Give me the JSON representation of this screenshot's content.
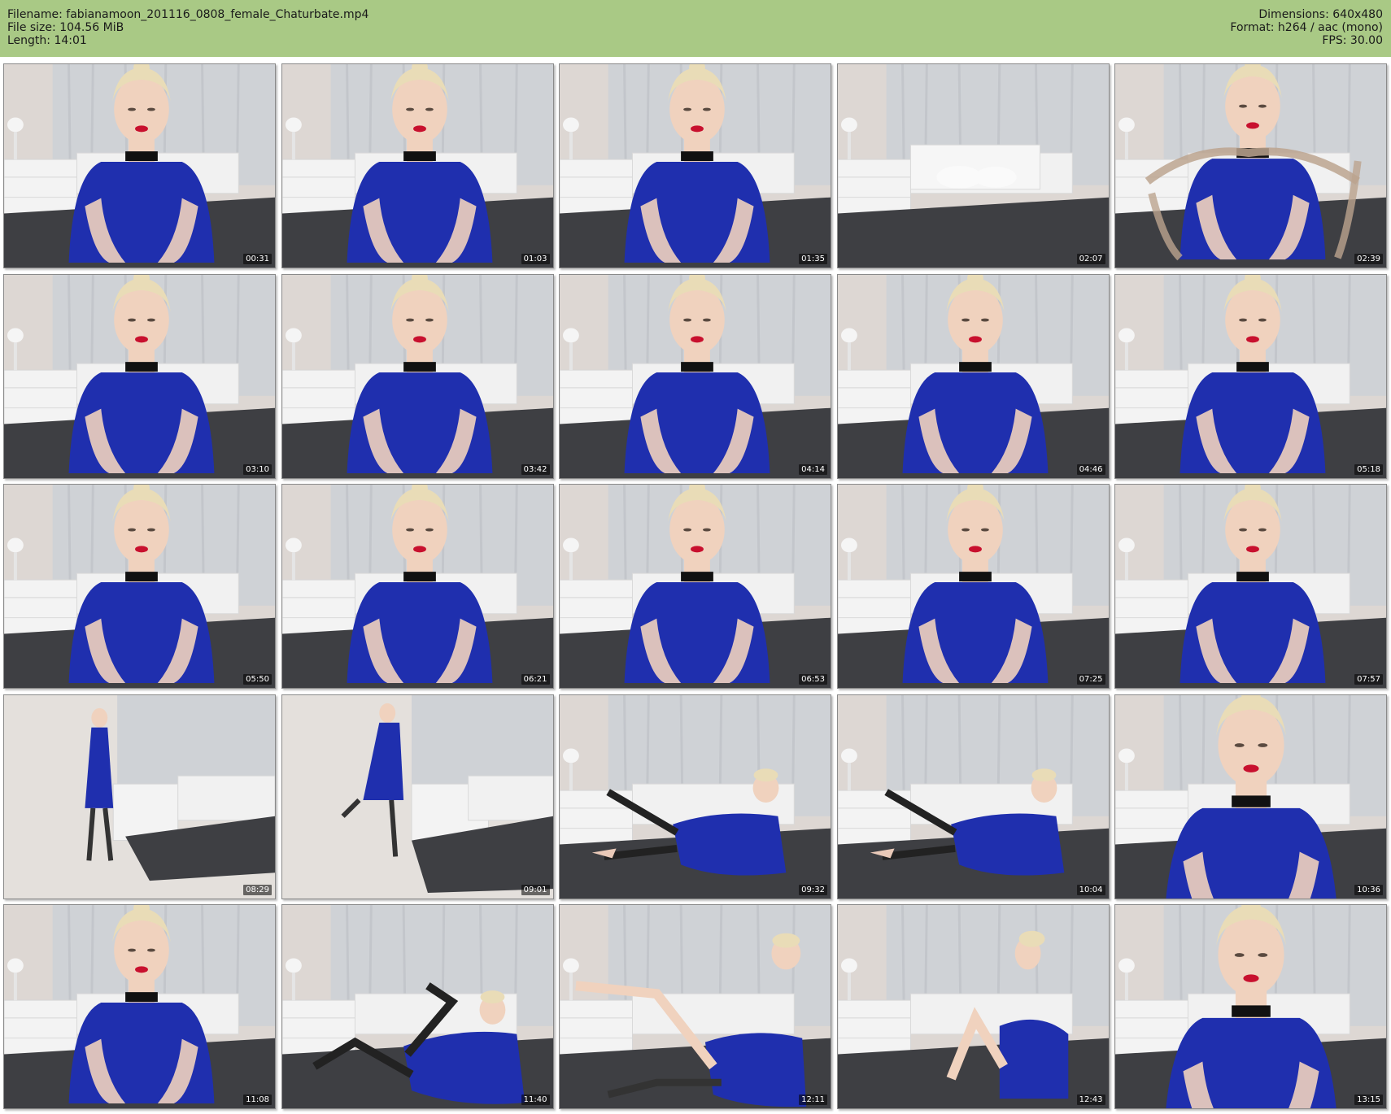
{
  "header": {
    "filename": "Filename: fabianamoon_201116_0808_female_Chaturbate.mp4",
    "filesize": "File size: 104.56 MiB",
    "length": "Length: 14:01",
    "dimensions": "Dimensions: 640x480",
    "format": "Format: h264 / aac (mono)",
    "fps": "FPS: 30.00"
  },
  "colors": {
    "header_bg": "#a9c985",
    "dress": "#1f2fae",
    "wall": "#ddd7d3",
    "curtain": "#cfd2d6",
    "bed_cover": "#3e3f43",
    "skin": "#f0d2be",
    "hair": "#e9dcb7"
  },
  "thumbnails": [
    {
      "time": "00:31",
      "scene": "sit-center"
    },
    {
      "time": "01:03",
      "scene": "sit-center"
    },
    {
      "time": "01:35",
      "scene": "sit-center"
    },
    {
      "time": "02:07",
      "scene": "empty-bed"
    },
    {
      "time": "02:39",
      "scene": "stockings-hold"
    },
    {
      "time": "03:10",
      "scene": "sit-center"
    },
    {
      "time": "03:42",
      "scene": "sit-center"
    },
    {
      "time": "04:14",
      "scene": "sit-center"
    },
    {
      "time": "04:46",
      "scene": "sit-center"
    },
    {
      "time": "05:18",
      "scene": "sit-center"
    },
    {
      "time": "05:50",
      "scene": "sit-center"
    },
    {
      "time": "06:21",
      "scene": "sit-center"
    },
    {
      "time": "06:53",
      "scene": "sit-center"
    },
    {
      "time": "07:25",
      "scene": "sit-center"
    },
    {
      "time": "07:57",
      "scene": "sit-center"
    },
    {
      "time": "08:29",
      "scene": "standing-left"
    },
    {
      "time": "09:01",
      "scene": "standing-wall"
    },
    {
      "time": "09:32",
      "scene": "lying-legs-up"
    },
    {
      "time": "10:04",
      "scene": "lying-legs-up"
    },
    {
      "time": "10:36",
      "scene": "close-up"
    },
    {
      "time": "11:08",
      "scene": "sit-center"
    },
    {
      "time": "11:40",
      "scene": "lying-stockings"
    },
    {
      "time": "12:11",
      "scene": "lying-leg-raise"
    },
    {
      "time": "12:43",
      "scene": "sitting-side"
    },
    {
      "time": "13:15",
      "scene": "close-up"
    }
  ]
}
